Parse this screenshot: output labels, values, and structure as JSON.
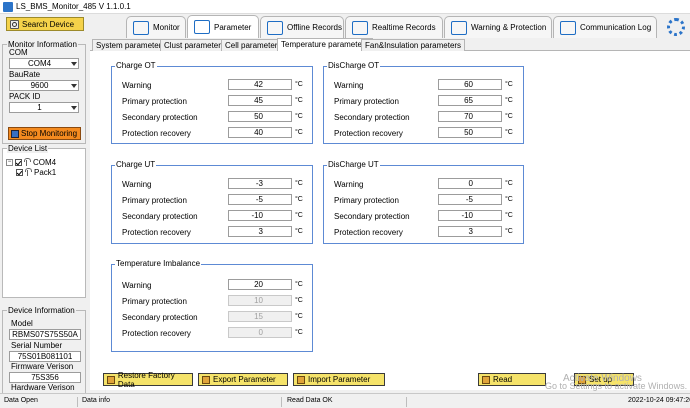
{
  "window": {
    "title": "LS_BMS_Monitor_485 V 1.1.0.1"
  },
  "left": {
    "search_button": "Search Device",
    "monitor_info": {
      "title": "Monitor Information",
      "com_label": "COM",
      "com_value": "COM4",
      "baurate_label": "BauRate",
      "baurate_value": "9600",
      "pack_label": "PACK ID",
      "pack_value": "1",
      "stop_button": "Stop Monitoring"
    },
    "device_list": {
      "title": "Device List",
      "root": "COM4",
      "child": "Pack1",
      "expander": "−"
    },
    "device_info": {
      "title": "Device Information",
      "model_label": "Model",
      "model_value": "RBMS07S75S50A",
      "serial_label": "Serial Number",
      "serial_value": "75S01B081101",
      "firmware_label": "Firmware Verison",
      "firmware_value": "75S356",
      "hardware_label": "Hardware Verison",
      "hardware_value": ""
    }
  },
  "tabs": [
    {
      "label": "Monitor"
    },
    {
      "label": "Parameter"
    },
    {
      "label": "Offline Records"
    },
    {
      "label": "Realtime Records"
    },
    {
      "label": "Warning & Protection"
    },
    {
      "label": "Communication Log"
    }
  ],
  "subtabs": [
    "System parameters",
    "Clust parameters",
    "Cell parameters",
    "Temperature parameters",
    "Fan&Insulation parameters"
  ],
  "unit": "°C",
  "groups": {
    "charge_ot": {
      "title": "Charge OT",
      "rows": [
        {
          "label": "Warning",
          "value": "42"
        },
        {
          "label": "Primary protection",
          "value": "45"
        },
        {
          "label": "Secondary protection",
          "value": "50"
        },
        {
          "label": "Protection recovery",
          "value": "40"
        }
      ]
    },
    "discharge_ot": {
      "title": "DisCharge OT",
      "rows": [
        {
          "label": "Warning",
          "value": "60"
        },
        {
          "label": "Primary protection",
          "value": "65"
        },
        {
          "label": "Secondary protection",
          "value": "70"
        },
        {
          "label": "Protection recovery",
          "value": "50"
        }
      ]
    },
    "charge_ut": {
      "title": "Charge UT",
      "rows": [
        {
          "label": "Warning",
          "value": "-3"
        },
        {
          "label": "Primary protection",
          "value": "-5"
        },
        {
          "label": "Secondary protection",
          "value": "-10"
        },
        {
          "label": "Protection recovery",
          "value": "3"
        }
      ]
    },
    "discharge_ut": {
      "title": "DisCharge UT",
      "rows": [
        {
          "label": "Warning",
          "value": "0"
        },
        {
          "label": "Primary protection",
          "value": "-5"
        },
        {
          "label": "Secondary protection",
          "value": "-10"
        },
        {
          "label": "Protection recovery",
          "value": "3"
        }
      ]
    },
    "temp_imbalance": {
      "title": "Temperature Imbalance",
      "rows": [
        {
          "label": "Warning",
          "value": "20"
        },
        {
          "label": "Primary protection",
          "value": "10"
        },
        {
          "label": "Secondary protection",
          "value": "15"
        },
        {
          "label": "Protection recovery",
          "value": "0"
        }
      ]
    }
  },
  "actions": {
    "restore": "Restore Factory Data",
    "export": "Export Parameter",
    "import": "Import Parameter",
    "read": "Read",
    "setup": "Set up"
  },
  "watermark": {
    "line1": "Activate Windows",
    "line2": "Go to Settings to activate Windows."
  },
  "status": {
    "open": "Data Open",
    "info": "Data info",
    "read": "Read Data OK",
    "time": "2022-10-24 09:47:26"
  },
  "colors": {
    "accent": "#2b74c9",
    "search_button": "#f5d24a",
    "stop_button": "#f48a1f",
    "action_button": "#f5e36a",
    "group_border": "#5d8ad4"
  }
}
